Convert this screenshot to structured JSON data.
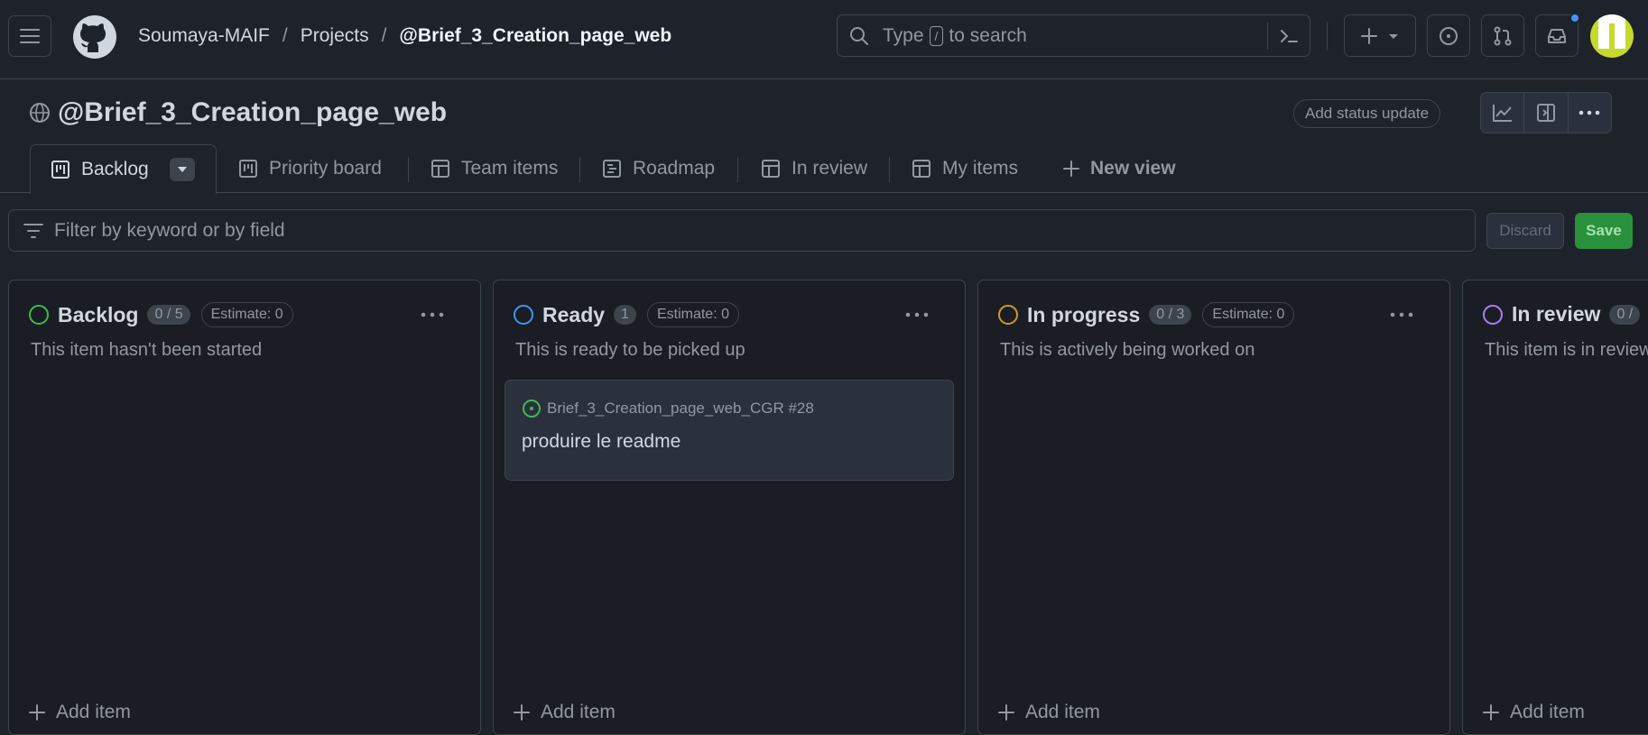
{
  "header": {
    "breadcrumb": {
      "owner": "Soumaya-MAIF",
      "section": "Projects",
      "project": "@Brief_3_Creation_page_web",
      "separator": "/"
    },
    "search": {
      "prefix": "Type",
      "key": "/",
      "suffix": "to search"
    }
  },
  "project": {
    "title": "@Brief_3_Creation_page_web",
    "status_update_label": "Add status update"
  },
  "views": {
    "active": "Backlog",
    "tabs": [
      "Priority board",
      "Team items",
      "Roadmap",
      "In review",
      "My items"
    ],
    "new_view": "New view"
  },
  "filter": {
    "placeholder": "Filter by keyword or by field",
    "discard": "Discard",
    "save": "Save"
  },
  "colors": {
    "accent_blue": "#4493f8",
    "green": "#3fb950",
    "orange": "#d29922",
    "purple": "#ab7df8"
  },
  "columns": [
    {
      "title": "Backlog",
      "count": "0 / 5",
      "estimate": "Estimate: 0",
      "description": "This item hasn't been started",
      "color": "#3fb950",
      "add": "Add item"
    },
    {
      "title": "Ready",
      "count": "1",
      "estimate": "Estimate: 0",
      "description": "This is ready to be picked up",
      "color": "#4493f8",
      "add": "Add item",
      "card": {
        "repo": "Brief_3_Creation_page_web_CGR #28",
        "title": "produire le readme"
      }
    },
    {
      "title": "In progress",
      "count": "0 / 3",
      "estimate": "Estimate: 0",
      "description": "This is actively being worked on",
      "color": "#d29922",
      "add": "Add item"
    },
    {
      "title": "In review",
      "count": "0 /",
      "description": "This item is in review",
      "color": "#ab7df8",
      "add": "Add item"
    }
  ]
}
